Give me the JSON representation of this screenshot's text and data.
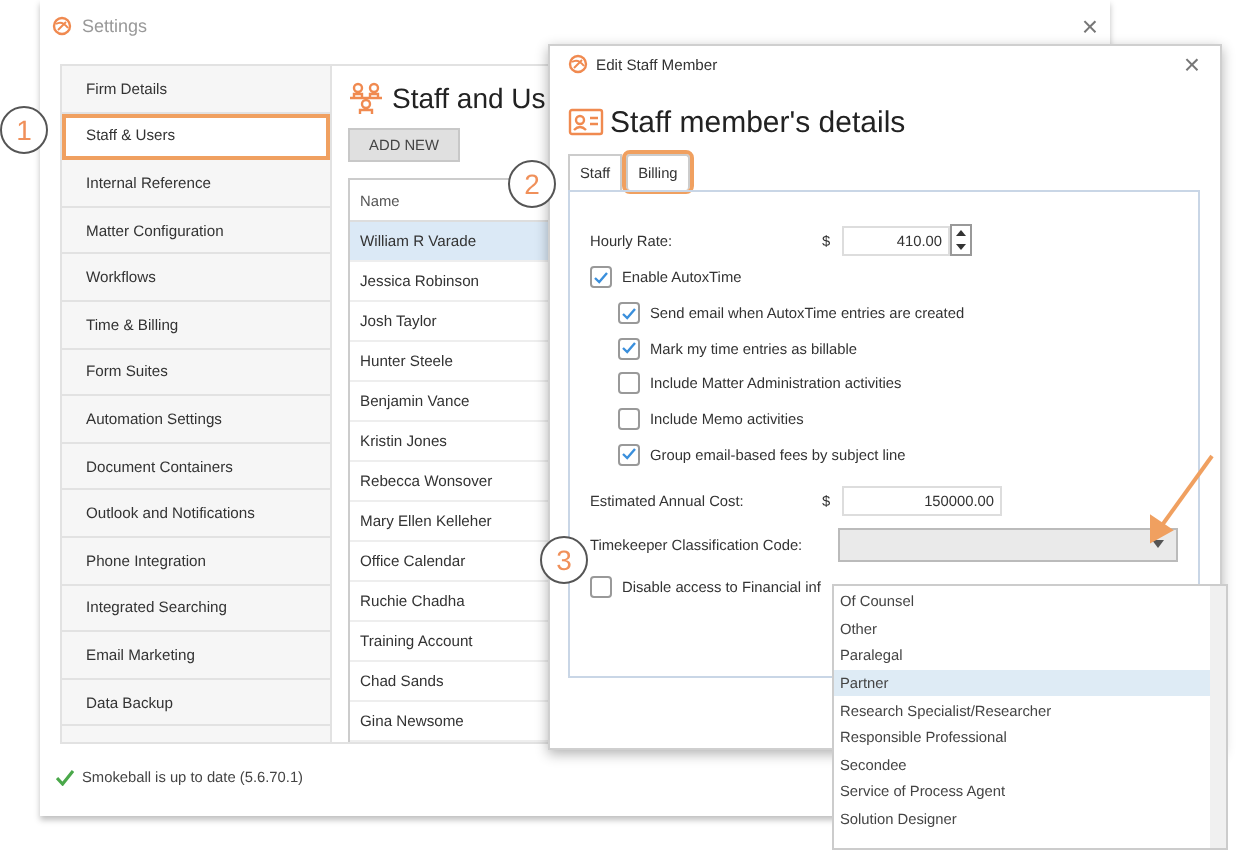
{
  "window": {
    "title": "Settings",
    "close": "×"
  },
  "sidebar": {
    "items": [
      {
        "label": "Firm Details",
        "selected": false
      },
      {
        "label": "Staff & Users",
        "selected": true
      },
      {
        "label": "Internal Reference",
        "selected": false
      },
      {
        "label": "Matter Configuration",
        "selected": false
      },
      {
        "label": "Workflows",
        "selected": false
      },
      {
        "label": "Time & Billing",
        "selected": false
      },
      {
        "label": "Form Suites",
        "selected": false
      },
      {
        "label": "Automation Settings",
        "selected": false
      },
      {
        "label": "Document Containers",
        "selected": false
      },
      {
        "label": "Outlook and Notifications",
        "selected": false
      },
      {
        "label": "Phone Integration",
        "selected": false
      },
      {
        "label": "Integrated Searching",
        "selected": false
      },
      {
        "label": "Email Marketing",
        "selected": false
      },
      {
        "label": "Data Backup",
        "selected": false
      }
    ]
  },
  "content": {
    "title": "Staff and Us",
    "add_button": "ADD NEW",
    "table": {
      "columns": [
        "Name"
      ],
      "rows": [
        {
          "name": "William R Varade",
          "selected": true
        },
        {
          "name": "Jessica Robinson",
          "selected": false
        },
        {
          "name": "Josh Taylor",
          "selected": false
        },
        {
          "name": "Hunter Steele",
          "selected": false
        },
        {
          "name": "Benjamin Vance",
          "selected": false
        },
        {
          "name": "Kristin Jones",
          "selected": false
        },
        {
          "name": "Rebecca Wonsover",
          "selected": false
        },
        {
          "name": "Mary Ellen Kelleher",
          "selected": false
        },
        {
          "name": "Office Calendar",
          "selected": false
        },
        {
          "name": "Ruchie Chadha",
          "selected": false
        },
        {
          "name": "Training Account",
          "selected": false
        },
        {
          "name": "Chad Sands",
          "selected": false
        },
        {
          "name": "Gina Newsome",
          "selected": false
        }
      ]
    }
  },
  "status_bar": {
    "text": "Smokeball is up to date (5.6.70.1)"
  },
  "dialog": {
    "title": "Edit Staff Member",
    "close": "×",
    "heading": "Staff member's details",
    "tabs": [
      {
        "label": "Staff",
        "selected": false
      },
      {
        "label": "Billing",
        "selected": true
      }
    ],
    "hourly_rate": {
      "label": "Hourly Rate:",
      "currency": "$",
      "value": "410.00"
    },
    "options": [
      {
        "label": "Enable AutoxTime",
        "checked": true,
        "children": [
          {
            "label": "Send email when AutoxTime entries are created",
            "checked": true
          },
          {
            "label": "Mark my time entries as billable",
            "checked": true
          },
          {
            "label": "Include Matter Administration activities",
            "checked": false
          },
          {
            "label": "Include Memo activities",
            "checked": false
          },
          {
            "label": "Group email-based fees by subject line",
            "checked": true
          }
        ]
      }
    ],
    "annual_cost": {
      "label": "Estimated Annual Cost:",
      "currency": "$",
      "value": "150000.00"
    },
    "classification": {
      "label": "Timekeeper Classification Code:",
      "expanded": true,
      "options": [
        {
          "label": "Of Counsel",
          "selected": false
        },
        {
          "label": "Other",
          "selected": false
        },
        {
          "label": "Paralegal",
          "selected": false
        },
        {
          "label": "Partner",
          "selected": true
        },
        {
          "label": "Research Specialist/Researcher",
          "selected": false
        },
        {
          "label": "Responsible Professional",
          "selected": false
        },
        {
          "label": "Secondee",
          "selected": false
        },
        {
          "label": "Service of Process Agent",
          "selected": false
        },
        {
          "label": "Solution Designer",
          "selected": false
        }
      ]
    },
    "disable_access": {
      "label": "Disable access to Financial inf",
      "checked": false
    }
  },
  "callouts": [
    "1",
    "2",
    "3"
  ]
}
